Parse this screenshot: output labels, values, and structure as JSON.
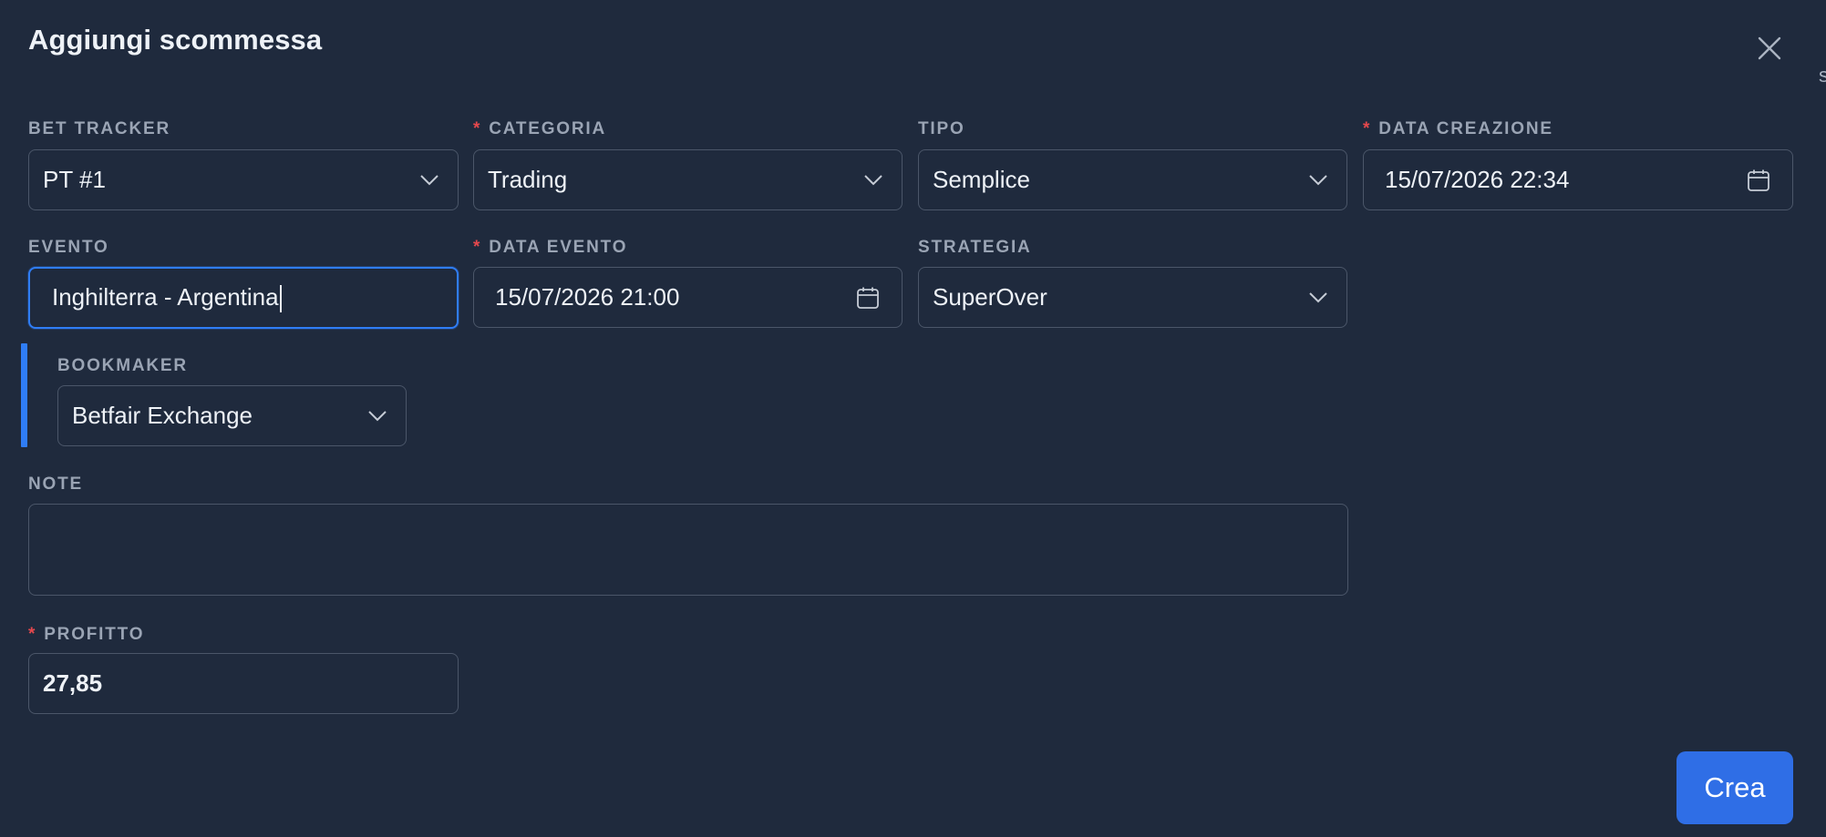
{
  "dialog": {
    "title": "Aggiungi scommessa"
  },
  "fields": {
    "bet_tracker": {
      "label": "BET TRACKER",
      "value": "PT #1",
      "required": false
    },
    "categoria": {
      "label": "CATEGORIA",
      "value": "Trading",
      "required": true
    },
    "tipo": {
      "label": "TIPO",
      "value": "Semplice",
      "required": false
    },
    "data_creazione": {
      "label": "DATA CREAZIONE",
      "value": "15/07/2026 22:34",
      "required": true
    },
    "evento": {
      "label": "EVENTO",
      "value": "Inghilterra - Argentina",
      "required": false
    },
    "data_evento": {
      "label": "DATA EVENTO",
      "value": "15/07/2026 21:00",
      "required": true
    },
    "strategia": {
      "label": "STRATEGIA",
      "value": "SuperOver",
      "required": false
    },
    "bookmaker": {
      "label": "BOOKMAKER",
      "value": "Betfair Exchange",
      "required": false
    },
    "note": {
      "label": "NOTE",
      "value": "",
      "required": false
    },
    "profitto": {
      "label": "PROFITTO",
      "value": "27,85",
      "required": true
    }
  },
  "required_marker": "*",
  "actions": {
    "create_label": "Crea"
  },
  "colors": {
    "background": "#1f2a3d",
    "accent": "#2f7df6",
    "primary_button": "#2f6ee6",
    "required_marker": "#e5484d",
    "border": "#4b5669"
  },
  "icons": {
    "close": "close-icon",
    "dropdown": "chevron-down-icon",
    "calendar": "calendar-icon"
  }
}
